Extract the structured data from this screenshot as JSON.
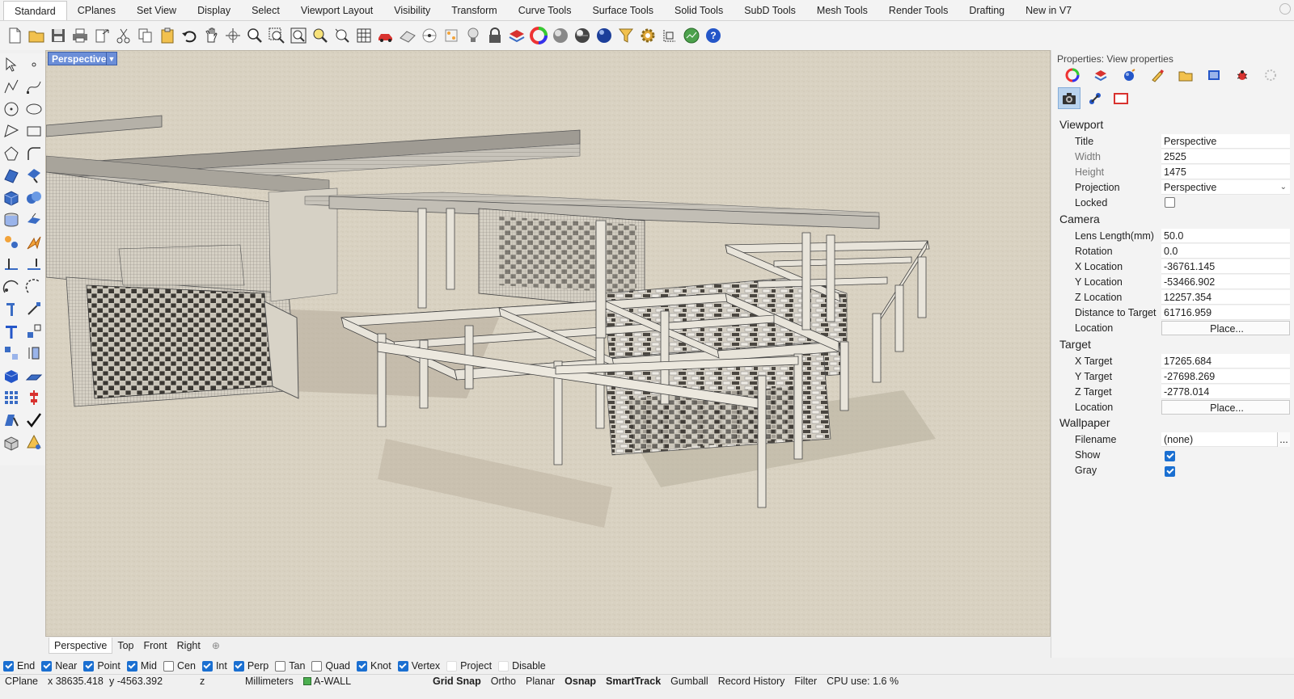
{
  "tabs": [
    "Standard",
    "CPlanes",
    "Set View",
    "Display",
    "Select",
    "Viewport Layout",
    "Visibility",
    "Transform",
    "Curve Tools",
    "Surface Tools",
    "Solid Tools",
    "SubD Tools",
    "Mesh Tools",
    "Render Tools",
    "Drafting",
    "New in V7"
  ],
  "toolbar_icons": [
    "new-icon",
    "open-icon",
    "save-icon",
    "print-icon",
    "export-icon",
    "cut-icon",
    "copy-icon",
    "paste-icon",
    "undo-icon",
    "pan-icon",
    "rotate-view-icon",
    "zoom-icon",
    "zoom-window-icon",
    "zoom-extents-icon",
    "zoom-selected-icon",
    "zoom-dynamic-icon",
    "grid-icon",
    "car-icon",
    "plane-icon",
    "cplane-icon",
    "coordinate-icon",
    "light-icon",
    "lock-icon",
    "layer-icon",
    "color-wheel-icon",
    "shaded-sphere-icon",
    "rendered-sphere-icon",
    "blue-sphere-icon",
    "select-filter-icon",
    "options-gear-icon",
    "dimension-icon",
    "globe-icon",
    "help-icon"
  ],
  "left_tool_icons": [
    "select-arrow-icon",
    "point-icon",
    "polyline-icon",
    "curve-icon",
    "circle-icon",
    "ellipse-icon",
    "arc-icon",
    "rectangle-icon",
    "polygon-icon",
    "fillet-icon",
    "surface-icon",
    "surface-edit-icon",
    "solid-box-icon",
    "boolean-icon",
    "cylinder-icon",
    "extrude-icon",
    "gumball-icon",
    "lightning-icon",
    "trim-icon",
    "split-icon",
    "join-icon",
    "explode-icon",
    "rotate-icon",
    "rotate3d-icon",
    "text-icon",
    "scale-icon",
    "move-icon",
    "mirror-icon",
    "solid-edit-icon",
    "plane-tool-icon",
    "array-icon",
    "align-icon",
    "analyze-icon",
    "check-icon",
    "mesh-icon",
    "render-icon"
  ],
  "viewport": {
    "title": "Perspective",
    "tabs": [
      "Perspective",
      "Top",
      "Front",
      "Right"
    ],
    "add_label": "⊕"
  },
  "osnap": [
    {
      "label": "End",
      "checked": true
    },
    {
      "label": "Near",
      "checked": true
    },
    {
      "label": "Point",
      "checked": true
    },
    {
      "label": "Mid",
      "checked": true
    },
    {
      "label": "Cen",
      "checked": false
    },
    {
      "label": "Int",
      "checked": true
    },
    {
      "label": "Perp",
      "checked": true
    },
    {
      "label": "Tan",
      "checked": false
    },
    {
      "label": "Quad",
      "checked": false
    },
    {
      "label": "Knot",
      "checked": true
    },
    {
      "label": "Vertex",
      "checked": true
    },
    {
      "label": "Project",
      "checked": false
    },
    {
      "label": "Disable",
      "checked": false
    }
  ],
  "status": {
    "cplane": "CPlane",
    "x": "x 38635.418",
    "y": "y -4563.392",
    "z": "z",
    "units": "Millimeters",
    "layer": "A-WALL",
    "grid_snap": "Grid Snap",
    "ortho": "Ortho",
    "planar": "Planar",
    "osnap": "Osnap",
    "smarttrack": "SmartTrack",
    "gumball": "Gumball",
    "record_history": "Record History",
    "filter": "Filter",
    "cpu": "CPU use: 1.6 %"
  },
  "properties": {
    "title": "Properties: View properties",
    "panel_icons": [
      "color-icon",
      "material-icon",
      "environment-icon",
      "paint-icon",
      "folder-icon",
      "image-icon",
      "bug-icon",
      "settings-icon"
    ],
    "sub_icons": [
      "camera-icon",
      "target-icon",
      "wallpaper-icon"
    ],
    "viewport_section": "Viewport",
    "title_label": "Title",
    "title_value": "Perspective",
    "width_label": "Width",
    "width_value": "2525",
    "height_label": "Height",
    "height_value": "1475",
    "projection_label": "Projection",
    "projection_value": "Perspective",
    "locked_label": "Locked",
    "camera_section": "Camera",
    "lens_label": "Lens Length(mm)",
    "lens_value": "50.0",
    "rotation_label": "Rotation",
    "rotation_value": "0.0",
    "xloc_label": "X Location",
    "xloc_value": "-36761.145",
    "yloc_label": "Y Location",
    "yloc_value": "-53466.902",
    "zloc_label": "Z Location",
    "zloc_value": "12257.354",
    "dist_label": "Distance to Target",
    "dist_value": "61716.959",
    "camloc_label": "Location",
    "camloc_button": "Place...",
    "target_section": "Target",
    "xt_label": "X Target",
    "xt_value": "17265.684",
    "yt_label": "Y Target",
    "yt_value": "-27698.269",
    "zt_label": "Z Target",
    "zt_value": "-2778.014",
    "tloc_label": "Location",
    "tloc_button": "Place...",
    "wallpaper_section": "Wallpaper",
    "filename_label": "Filename",
    "filename_value": "(none)",
    "filename_dots": "...",
    "show_label": "Show",
    "gray_label": "Gray"
  }
}
